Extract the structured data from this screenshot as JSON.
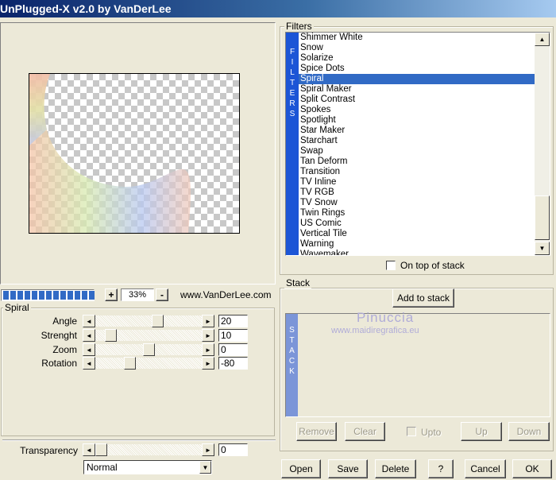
{
  "window": {
    "title": "UnPlugged-X v2.0 by VanDerLee"
  },
  "preview": {
    "zoom_value": "33%",
    "zoom_minus": "-",
    "zoom_plus": "+",
    "website": "www.VanDerLee.com",
    "progress_segments": 13
  },
  "spiral": {
    "group_label": "Spiral",
    "params": [
      {
        "label": "Angle",
        "value": "20",
        "level": 0.6
      },
      {
        "label": "Strenght",
        "value": "10",
        "level": 0.1
      },
      {
        "label": "Zoom",
        "value": "0",
        "level": 0.5
      },
      {
        "label": "Rotation",
        "value": "-80",
        "level": 0.3
      }
    ]
  },
  "transparency": {
    "label": "Transparency",
    "value": "0",
    "level": 0.0
  },
  "blend_mode": {
    "selected": "Normal"
  },
  "filters": {
    "group_label": "Filters",
    "vertical_label": [
      "F",
      "I",
      "L",
      "T",
      "E",
      "R",
      "S"
    ],
    "items": [
      "Shimmer White",
      "Snow",
      "Solarize",
      "Spice Dots",
      "Spiral",
      "Spiral Maker",
      "Split Contrast",
      "Spokes",
      "Spotlight",
      "Star Maker",
      "Starchart",
      "Swap",
      "Tan Deform",
      "Transition",
      "TV Inline",
      "TV RGB",
      "TV Snow",
      "Twin Rings",
      "US Comic",
      "Vertical Tile",
      "Warning",
      "Wavemaker"
    ],
    "selected_index": 4,
    "on_top_label": "On top of stack"
  },
  "stack": {
    "group_label": "Stack",
    "add_label": "Add to stack",
    "vertical_label": [
      "S",
      "T",
      "A",
      "C",
      "K"
    ],
    "watermark_title": "Pinuccia",
    "watermark_url": "www.maidiregrafica.eu",
    "remove_label": "Remove",
    "clear_label": "Clear",
    "upto_label": "Upto",
    "up_label": "Up",
    "down_label": "Down"
  },
  "footer": {
    "open_label": "Open",
    "save_label": "Save",
    "delete_label": "Delete",
    "help_label": "?",
    "cancel_label": "Cancel",
    "ok_label": "OK"
  },
  "colors": {
    "accent": "#316ac5",
    "stack_bar": "#7b95d8",
    "face": "#ece9d8"
  },
  "icons": {
    "scroll_up": "▲",
    "scroll_down": "▼",
    "arrow_left": "◄",
    "arrow_right": "►",
    "dropdown": "▼"
  }
}
